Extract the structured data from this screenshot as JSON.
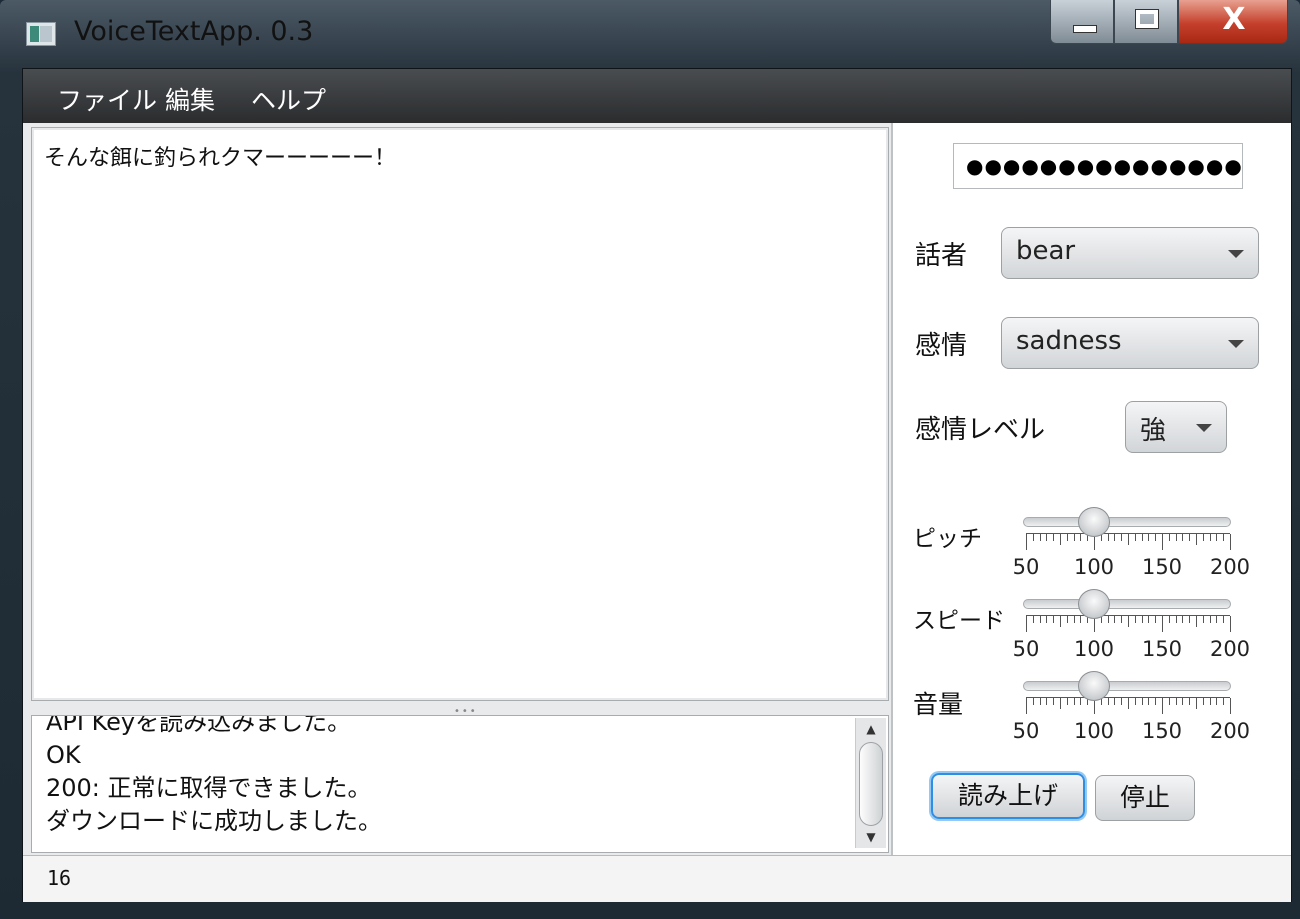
{
  "window": {
    "title": "VoiceTextApp. 0.3",
    "min_icon": "minimize-icon",
    "max_icon": "maximize-icon",
    "close_icon": "close-icon",
    "close_glyph": "X"
  },
  "menu": {
    "items": [
      "ファイル",
      "編集",
      "ヘルプ"
    ]
  },
  "editor": {
    "text": "そんな餌に釣られクマーーーーー！"
  },
  "log": {
    "lines": [
      "API Keyを読み込みました。",
      "OK",
      "200: 正常に取得できました。",
      "ダウンロードに成功しました。"
    ]
  },
  "status": {
    "text": "16"
  },
  "side": {
    "api_key_masked": "●●●●●●●●●●●●●●●●●●",
    "speaker": {
      "label": "話者",
      "value": "bear"
    },
    "emotion": {
      "label": "感情",
      "value": "sadness"
    },
    "emotion_level": {
      "label": "感情レベル",
      "value": "強"
    },
    "sliders": [
      {
        "label": "ピッチ",
        "value": 100,
        "min": 50,
        "max": 200,
        "ticks": [
          "50",
          "100",
          "150",
          "200"
        ]
      },
      {
        "label": "スピード",
        "value": 100,
        "min": 50,
        "max": 200,
        "ticks": [
          "50",
          "100",
          "150",
          "200"
        ]
      },
      {
        "label": "音量",
        "value": 100,
        "min": 50,
        "max": 200,
        "ticks": [
          "50",
          "100",
          "150",
          "200"
        ]
      }
    ],
    "read_button": "読み上げ",
    "stop_button": "停止"
  },
  "colors": {
    "focus": "#2f8ee4",
    "menubar": "#2a2c2e",
    "close": "#c4402c"
  }
}
